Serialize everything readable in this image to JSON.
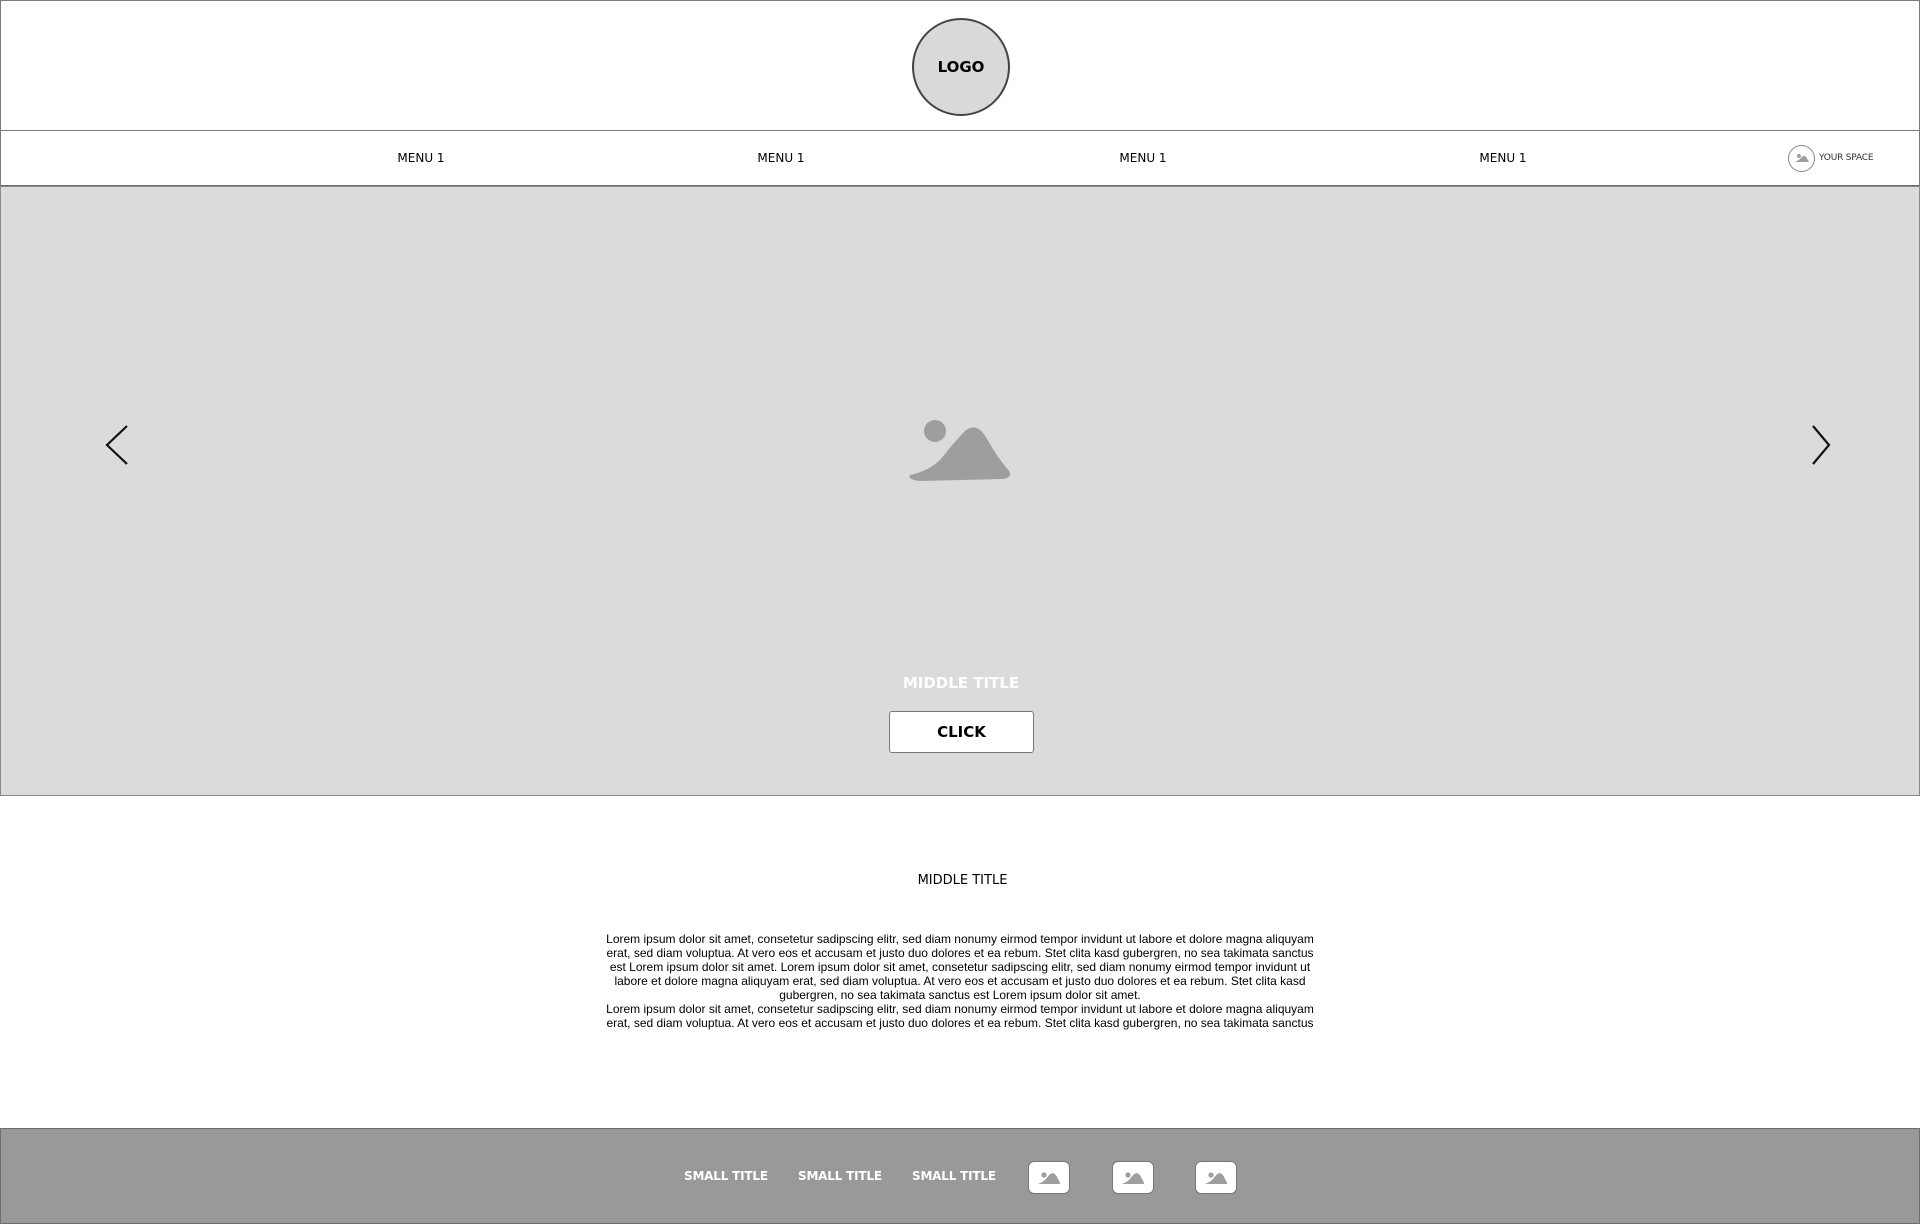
{
  "header": {
    "logo_label": "LOGO"
  },
  "nav": {
    "items": [
      {
        "label": "MENU 1"
      },
      {
        "label": "MENU 1"
      },
      {
        "label": "MENU 1"
      },
      {
        "label": "MENU 1"
      }
    ],
    "account": {
      "label": "YOUR SPACE",
      "icon": "image-placeholder-icon"
    }
  },
  "hero": {
    "image_icon": "image-placeholder-icon",
    "prev_icon": "chevron-left-icon",
    "next_icon": "chevron-right-icon",
    "title": "MIDDLE TITLE",
    "button_label": "CLICK"
  },
  "content": {
    "title": "MIDDLE TITLE",
    "paragraphs": [
      "Lorem ipsum dolor sit amet, consetetur sadipscing elitr, sed diam nonumy eirmod tempor invidunt ut labore et dolore magna aliquyam erat, sed diam voluptua. At vero eos et accusam et justo duo dolores et ea rebum. Stet clita kasd gubergren, no sea takimata sanctus est Lorem ipsum dolor sit amet. Lorem ipsum dolor sit amet, consetetur sadipscing elitr, sed diam nonumy eirmod tempor invidunt ut labore et dolore magna aliquyam erat, sed diam voluptua. At vero eos et accusam et justo duo dolores et ea rebum. Stet clita kasd gubergren, no sea takimata sanctus est Lorem ipsum dolor sit amet.",
      "Lorem ipsum dolor sit amet, consetetur sadipscing elitr, sed diam nonumy eirmod tempor invidunt ut labore et dolore magna aliquyam erat, sed diam voluptua. At vero eos et accusam et justo duo dolores et ea rebum. Stet clita kasd gubergren, no sea takimata sanctus"
    ]
  },
  "footer": {
    "links": [
      {
        "label": "SMALL TITLE"
      },
      {
        "label": "SMALL TITLE"
      },
      {
        "label": "SMALL TITLE"
      }
    ],
    "social_icons": [
      "image-placeholder-icon",
      "image-placeholder-icon",
      "image-placeholder-icon"
    ]
  },
  "colors": {
    "hero_bg": "#dbdbdb",
    "footer_bg": "#999999",
    "placeholder_icon": "#9e9e9e"
  }
}
